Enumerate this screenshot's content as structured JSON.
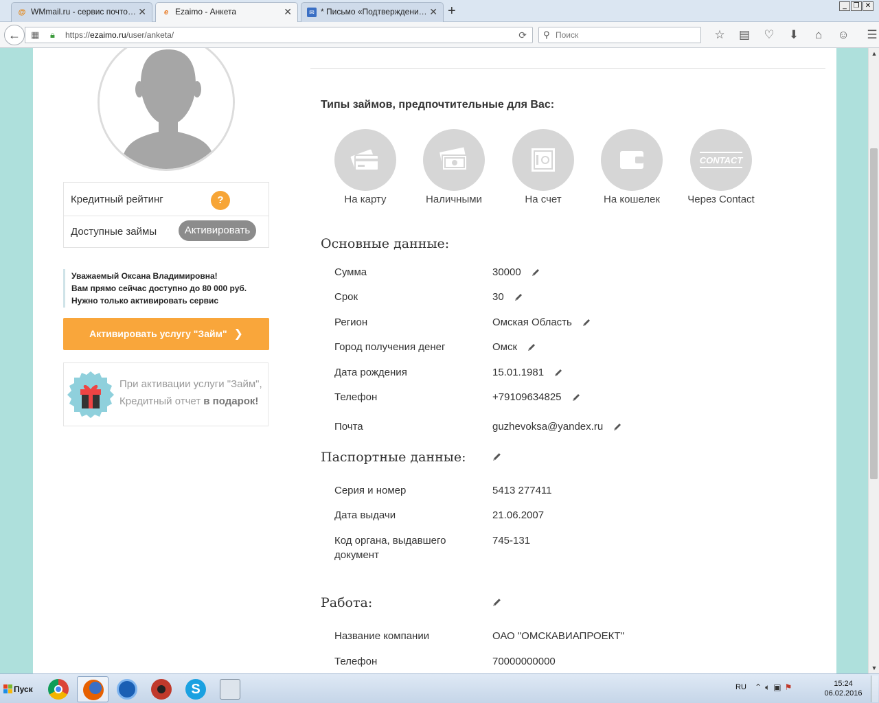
{
  "browser": {
    "tabs": [
      {
        "title": "WMmail.ru - сервис почтовы...",
        "favicon": "at-icon",
        "active": false
      },
      {
        "title": "Ezaimo - Анкета",
        "favicon": "ezaimo-icon",
        "active": true
      },
      {
        "title": "* Письмо «Подтверждение ...",
        "favicon": "mail-icon",
        "active": false
      }
    ],
    "url_prefix": "https://",
    "url_host": "ezaimo.ru",
    "url_path": "/user/anketa/",
    "search_placeholder": "Поиск"
  },
  "sidebar": {
    "credit_rating_label": "Кредитный рейтинг",
    "credit_rating_badge": "?",
    "available_loans_label": "Доступные займы",
    "activate_pill_label": "Активировать",
    "notice_lines": [
      "Уважаемый Оксана Владимировна!",
      "Вам прямо сейчас доступно до 80 000 руб.",
      "Нужно только активировать сервис"
    ],
    "activate_button_label": "Активировать услугу \"Займ\"",
    "gift_line1": "При активации услуги \"Займ\",",
    "gift_line2_plain": "Кредитный отчет ",
    "gift_line2_bold": "в подарок!"
  },
  "loan_types": {
    "title": "Типы займов, предпочтительные для Вас:",
    "items": [
      {
        "label": "На карту",
        "icon": "card-icon"
      },
      {
        "label": "Наличными",
        "icon": "cash-icon"
      },
      {
        "label": "На счет",
        "icon": "safe-icon"
      },
      {
        "label": "На кошелек",
        "icon": "wallet-icon"
      },
      {
        "label": "Через Contact",
        "icon": "contact-logo-icon"
      }
    ]
  },
  "main_data": {
    "title": "Основные данные:",
    "rows": [
      {
        "label": "Сумма",
        "value": "30000"
      },
      {
        "label": "Срок",
        "value": "30"
      },
      {
        "label": "Регион",
        "value": "Омская Область"
      },
      {
        "label": "Город получения денег",
        "value": "Омск"
      },
      {
        "label": "Дата рождения",
        "value": "15.01.1981"
      },
      {
        "label": "Телефон",
        "value": "+79109634825"
      },
      {
        "label": "Почта",
        "value": "guzhevoksa@yandex.ru"
      }
    ]
  },
  "passport": {
    "title": "Паспортные данные:",
    "rows": [
      {
        "label": "Серия и номер",
        "value": "5413 277411"
      },
      {
        "label": "Дата выдачи",
        "value": "21.06.2007"
      },
      {
        "label": "Код органа, выдавшего документ",
        "value": "745-131"
      }
    ]
  },
  "work": {
    "title": "Работа:",
    "rows": [
      {
        "label": "Название компании",
        "value": "ОАО \"ОМСКАВИАПРОЕКТ\""
      },
      {
        "label": "Телефон",
        "value": "70000000000"
      }
    ]
  },
  "taskbar": {
    "start_label": "Пуск",
    "apps": [
      "chrome-icon",
      "firefox-icon",
      "ccleaner-icon",
      "avast-icon",
      "skype-icon",
      "calculator-icon"
    ],
    "lang": "RU",
    "time": "15:24",
    "date": "06.02.2016"
  },
  "colors": {
    "accent_orange": "#f9a63b",
    "page_bg": "#aee0dc",
    "icon_grey": "#d6d6d6"
  }
}
